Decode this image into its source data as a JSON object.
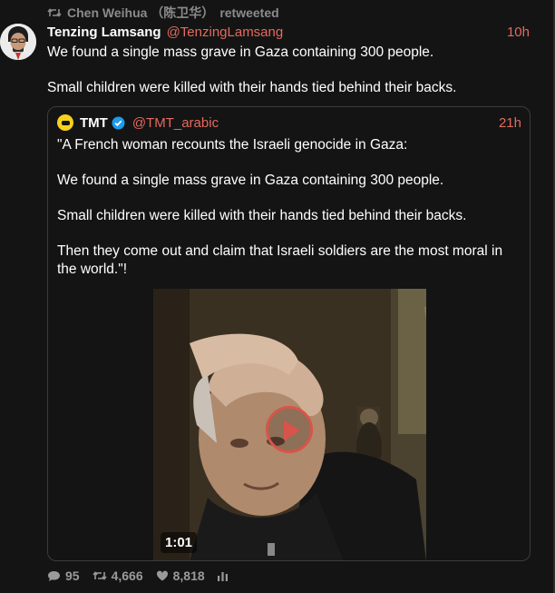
{
  "retweet": {
    "icon": "retweet-icon",
    "retweeter": "Chen Weihua （陈卫华）",
    "suffix": "retweeted"
  },
  "tweet": {
    "avatar": "avatar-portrait",
    "author_name": "Tenzing Lamsang",
    "author_handle": "@TenzingLamsang",
    "time": "10h",
    "paragraphs": [
      "We found a single mass grave in Gaza containing 300 people.",
      "Small children were killed with their hands tied behind their backs."
    ]
  },
  "quote": {
    "logo": "tmt-logo",
    "name": "TMT",
    "verified_icon": "verified-badge-icon",
    "handle": "@TMT_arabic",
    "time": "21h",
    "paragraphs": [
      "\"A French woman recounts the Israeli genocide in Gaza:",
      "We found a single mass grave in Gaza containing 300 people.",
      "Small children were killed with their hands tied behind their backs.",
      "Then they come out and claim that Israeli soldiers are the most moral in the world.\"!"
    ],
    "video": {
      "duration": "1:01",
      "play_icon": "play-icon"
    }
  },
  "actions": {
    "replies": "95",
    "retweets": "4,666",
    "likes": "8,818",
    "stats_icon": "stats-icon"
  },
  "colors": {
    "background": "#141414",
    "accent": "#e46a5e",
    "muted": "#8b8b8b",
    "border": "#3c3c3c",
    "play": "#d8544a"
  }
}
